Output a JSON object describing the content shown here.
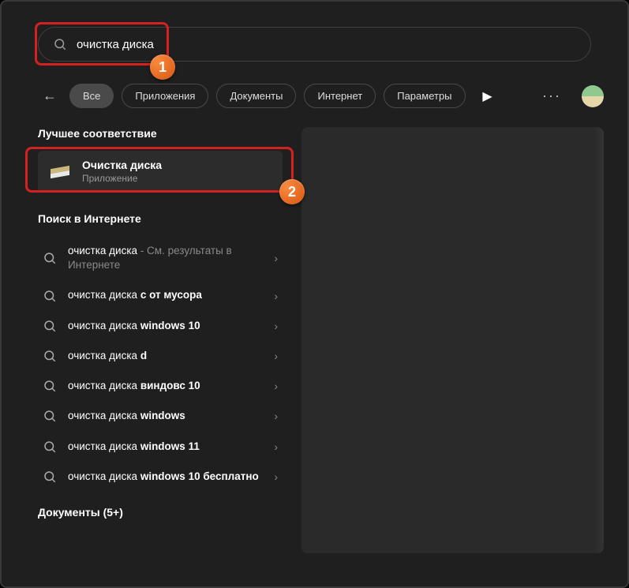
{
  "search": {
    "value": "очистка диска"
  },
  "tabs": {
    "back_glyph": "←",
    "all": "Все",
    "apps": "Приложения",
    "docs": "Документы",
    "internet": "Интернет",
    "settings": "Параметры",
    "play_glyph": "▶",
    "more_glyph": "···"
  },
  "markers": {
    "m1": "1",
    "m2": "2"
  },
  "sections": {
    "best_match": "Лучшее соответствие",
    "web_search": "Поиск в Интернете",
    "documents": "Документы (5+)"
  },
  "best": {
    "title": "Очистка диска",
    "subtitle": "Приложение"
  },
  "results": [
    {
      "prefix": "очистка диска",
      "bold": "",
      "hint": " - См. результаты в Интернете"
    },
    {
      "prefix": "очистка диска ",
      "bold": "с от мусора",
      "hint": ""
    },
    {
      "prefix": "очистка диска ",
      "bold": "windows 10",
      "hint": ""
    },
    {
      "prefix": "очистка диска ",
      "bold": "d",
      "hint": ""
    },
    {
      "prefix": "очистка диска ",
      "bold": "виндовс 10",
      "hint": ""
    },
    {
      "prefix": "очистка диска ",
      "bold": "windows",
      "hint": ""
    },
    {
      "prefix": "очистка диска ",
      "bold": "windows 11",
      "hint": ""
    },
    {
      "prefix": "очистка диска ",
      "bold": "windows 10 бесплатно",
      "hint": ""
    }
  ],
  "glyphs": {
    "chevron": "›"
  }
}
